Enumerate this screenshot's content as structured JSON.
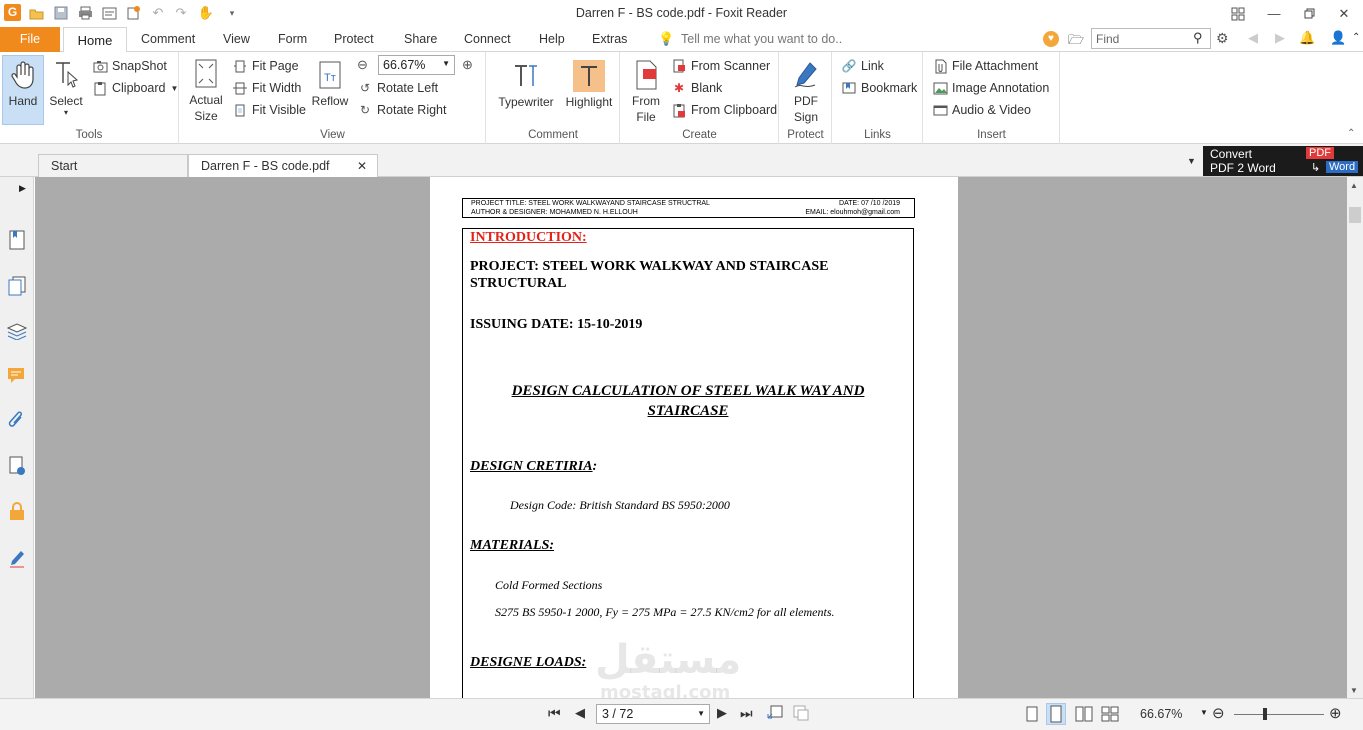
{
  "window": {
    "title": "Darren F - BS code.pdf - Foxit Reader",
    "app_logo": "G"
  },
  "menu": {
    "file": "File",
    "tabs": [
      "Home",
      "Comment",
      "View",
      "Form",
      "Protect",
      "Share",
      "Connect",
      "Help",
      "Extras"
    ],
    "tell_me": "Tell me what you want to do..",
    "find_placeholder": "Find"
  },
  "ribbon": {
    "tools": {
      "hand": "Hand",
      "select": "Select",
      "snapshot": "SnapShot",
      "clipboard": "Clipboard",
      "label": "Tools"
    },
    "view": {
      "actual_size": "Actual Size",
      "fit_page": "Fit Page",
      "fit_width": "Fit Width",
      "fit_visible": "Fit Visible",
      "reflow": "Reflow",
      "zoom": "66.67%",
      "rotate_left": "Rotate Left",
      "rotate_right": "Rotate Right",
      "label": "View"
    },
    "comment": {
      "typewriter": "Typewriter",
      "highlight": "Highlight",
      "label": "Comment"
    },
    "create": {
      "from_file": "From File",
      "from_scanner": "From Scanner",
      "blank": "Blank",
      "from_clipboard": "From Clipboard",
      "label": "Create"
    },
    "protect": {
      "pdf_sign": "PDF Sign",
      "label": "Protect"
    },
    "links": {
      "link": "Link",
      "bookmark": "Bookmark",
      "label": "Links"
    },
    "insert": {
      "file_attachment": "File Attachment",
      "image_annotation": "Image Annotation",
      "audio_video": "Audio & Video",
      "label": "Insert"
    }
  },
  "doc_tabs": {
    "start": "Start",
    "current": "Darren F - BS code.pdf"
  },
  "convert_ad": {
    "line1": "Convert",
    "line2": "PDF 2 Word",
    "badge_pdf": "PDF",
    "badge_word": "Word"
  },
  "document": {
    "header": {
      "project_title": "PROJECT TITLE:  STEEL WORK WALKWAYAND STAIRCASE STRUCTRAL",
      "date": "DATE: 07 /10 /2019",
      "author": "AUTHOR & DESIGNER: MOHAMMED N. H.ELLOUH",
      "email": "EMAIL: elouhmoh@gmail.com"
    },
    "introduction": "INTRODUCTION:",
    "project_line1": "PROJECT:  STEEL WORK WALKWAY AND STAIRCASE",
    "project_line2": "STRUCTURAL",
    "issuing_date": "ISSUING DATE: 15-10-2019",
    "design_calc_line1": "DESIGN CALCULATION OF STEEL WALK WAY AND",
    "design_calc_line2": "STAIRCASE",
    "design_criteria": "DESIGN CRETIRIA",
    "design_criteria_colon": ":",
    "design_code": "Design Code: British Standard BS 5950:2000",
    "materials": "MATERIALS:",
    "cold_formed": "Cold Formed Sections",
    "s275": "S275 BS 5950-1 2000, Fy = 275 MPa = 27.5 KN/cm2  for all elements.",
    "design_loads": "DESIGNE LOADS:"
  },
  "watermark": {
    "arabic": "مستقل",
    "latin": "mostaql.com"
  },
  "status": {
    "page": "3 / 72",
    "zoom": "66.67%",
    "zoom_level_fraction": 0.34
  },
  "colors": {
    "accent": "#f08a1d",
    "viewer_bg": "#ababab",
    "intro_red": "#e2231a"
  }
}
